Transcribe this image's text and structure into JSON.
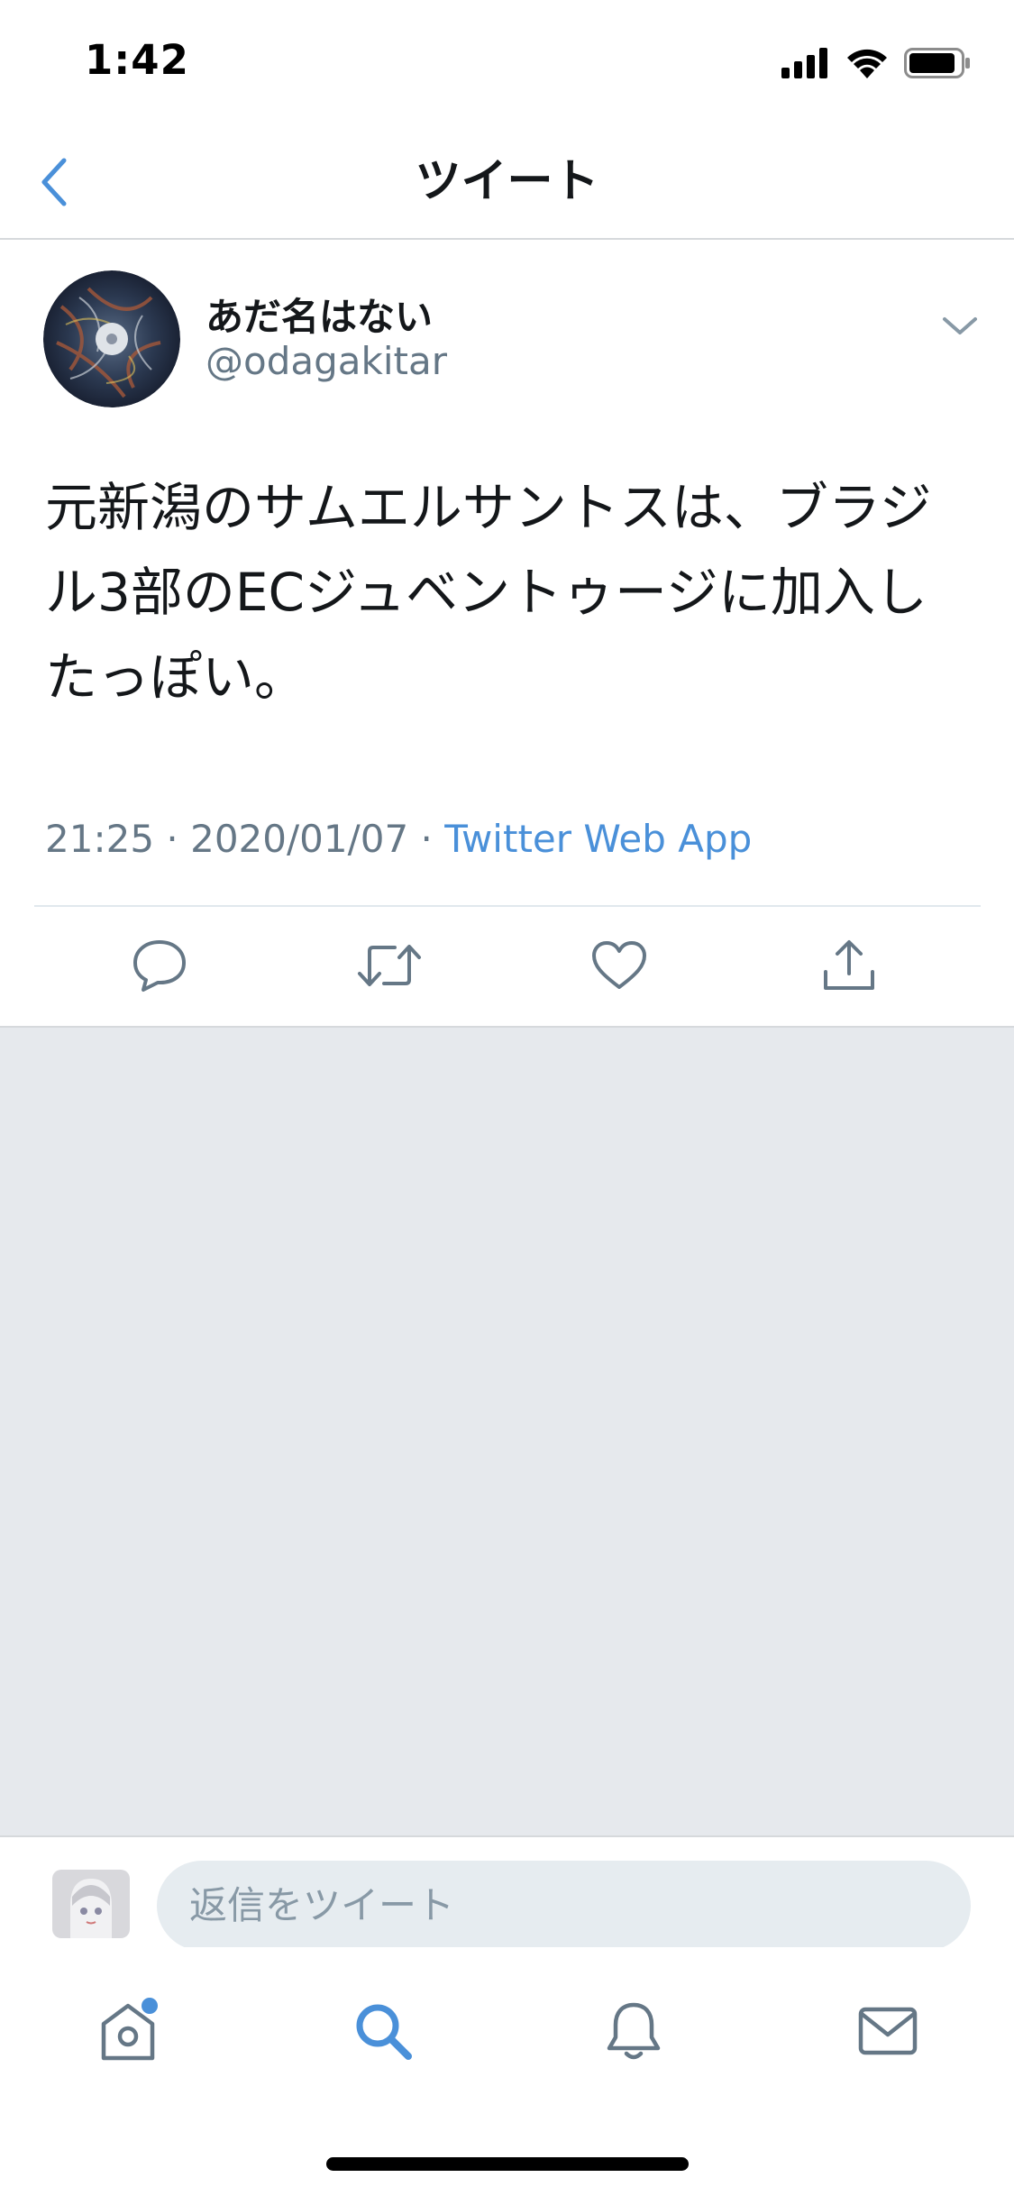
{
  "status": {
    "time": "1:42"
  },
  "nav": {
    "title": "ツイート"
  },
  "tweet": {
    "display_name": "あだ名はない",
    "handle": "@odagakitar",
    "text": "元新潟のサムエルサントスは、ブラジル3部のECジュベントゥージに加入したっぽい。",
    "time": "21:25",
    "date": "2020/01/07",
    "separator": " · ",
    "source": "Twitter Web App"
  },
  "reply": {
    "placeholder": "返信をツイート"
  },
  "actions": [
    "reply-icon",
    "retweet-icon",
    "like-icon",
    "share-icon"
  ],
  "tabs": [
    "home-icon",
    "search-icon",
    "notifications-icon",
    "messages-icon"
  ],
  "colors": {
    "accent": "#4a90d9",
    "secondary_text": "#657786",
    "background_gray": "#e6e9ed"
  }
}
